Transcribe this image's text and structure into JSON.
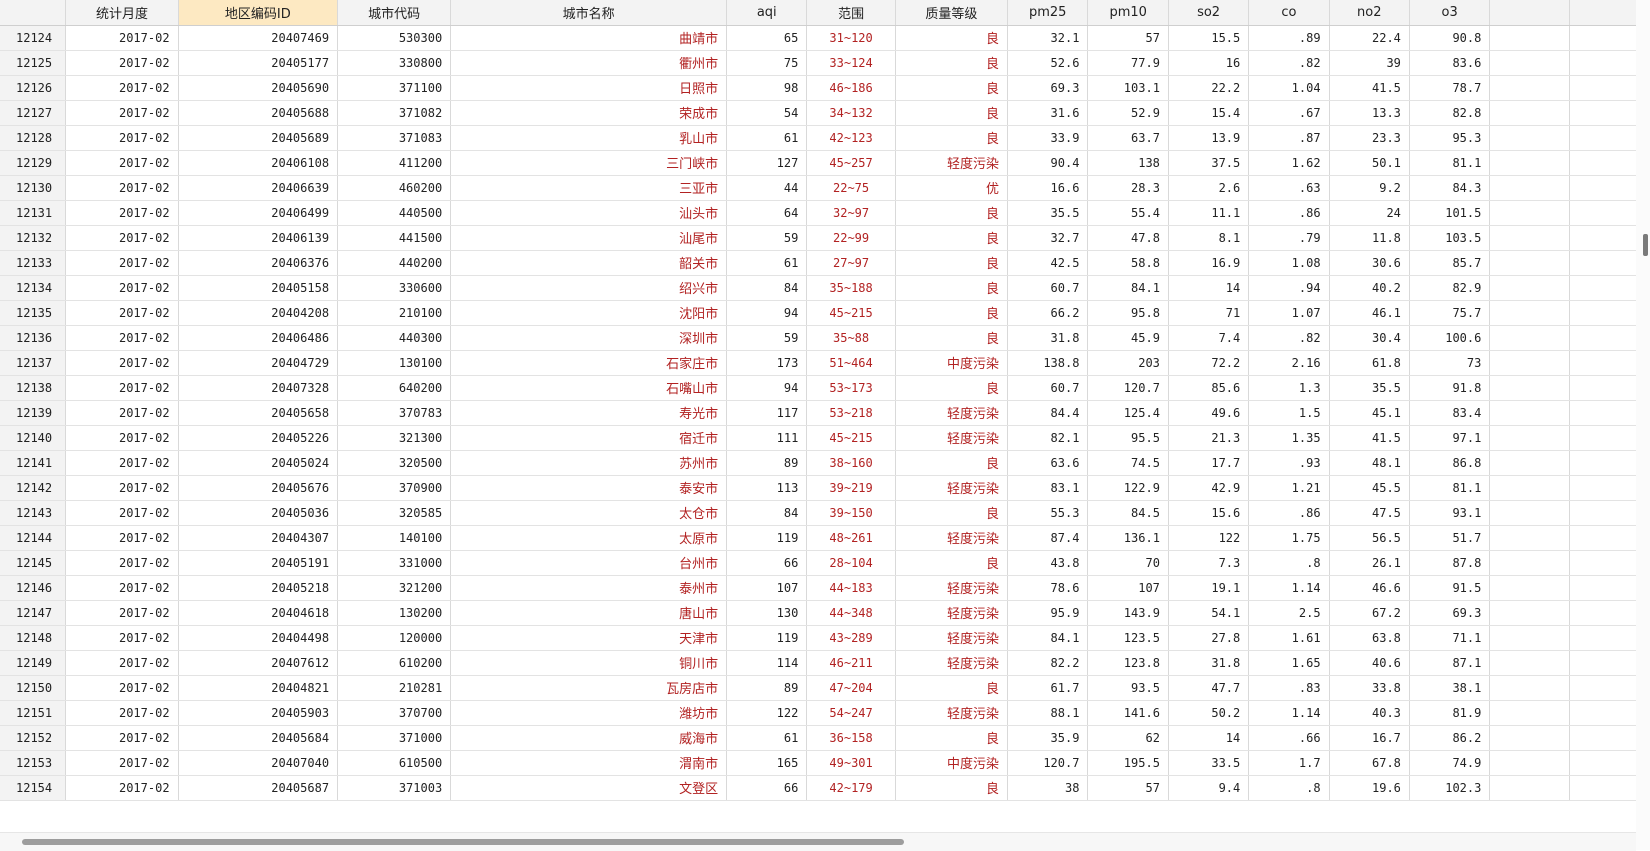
{
  "headers": [
    "",
    "统计月度",
    "地区编码ID",
    "城市代码",
    "城市名称",
    "aqi",
    "范围",
    "质量等级",
    "pm25",
    "pm10",
    "so2",
    "co",
    "no2",
    "o3"
  ],
  "colors": {
    "accent_text": "#b22222",
    "selected_header": "#fde9c2",
    "header_bg": "#f3f3f3"
  },
  "rows": [
    [
      "12124",
      "2017-02",
      "20407469",
      "530300",
      "曲靖市",
      "65",
      "31~120",
      "良",
      "32.1",
      "57",
      "15.5",
      ".89",
      "22.4",
      "90.8"
    ],
    [
      "12125",
      "2017-02",
      "20405177",
      "330800",
      "衢州市",
      "75",
      "33~124",
      "良",
      "52.6",
      "77.9",
      "16",
      ".82",
      "39",
      "83.6"
    ],
    [
      "12126",
      "2017-02",
      "20405690",
      "371100",
      "日照市",
      "98",
      "46~186",
      "良",
      "69.3",
      "103.1",
      "22.2",
      "1.04",
      "41.5",
      "78.7"
    ],
    [
      "12127",
      "2017-02",
      "20405688",
      "371082",
      "荣成市",
      "54",
      "34~132",
      "良",
      "31.6",
      "52.9",
      "15.4",
      ".67",
      "13.3",
      "82.8"
    ],
    [
      "12128",
      "2017-02",
      "20405689",
      "371083",
      "乳山市",
      "61",
      "42~123",
      "良",
      "33.9",
      "63.7",
      "13.9",
      ".87",
      "23.3",
      "95.3"
    ],
    [
      "12129",
      "2017-02",
      "20406108",
      "411200",
      "三门峡市",
      "127",
      "45~257",
      "轻度污染",
      "90.4",
      "138",
      "37.5",
      "1.62",
      "50.1",
      "81.1"
    ],
    [
      "12130",
      "2017-02",
      "20406639",
      "460200",
      "三亚市",
      "44",
      "22~75",
      "优",
      "16.6",
      "28.3",
      "2.6",
      ".63",
      "9.2",
      "84.3"
    ],
    [
      "12131",
      "2017-02",
      "20406499",
      "440500",
      "汕头市",
      "64",
      "32~97",
      "良",
      "35.5",
      "55.4",
      "11.1",
      ".86",
      "24",
      "101.5"
    ],
    [
      "12132",
      "2017-02",
      "20406139",
      "441500",
      "汕尾市",
      "59",
      "22~99",
      "良",
      "32.7",
      "47.8",
      "8.1",
      ".79",
      "11.8",
      "103.5"
    ],
    [
      "12133",
      "2017-02",
      "20406376",
      "440200",
      "韶关市",
      "61",
      "27~97",
      "良",
      "42.5",
      "58.8",
      "16.9",
      "1.08",
      "30.6",
      "85.7"
    ],
    [
      "12134",
      "2017-02",
      "20405158",
      "330600",
      "绍兴市",
      "84",
      "35~188",
      "良",
      "60.7",
      "84.1",
      "14",
      ".94",
      "40.2",
      "82.9"
    ],
    [
      "12135",
      "2017-02",
      "20404208",
      "210100",
      "沈阳市",
      "94",
      "45~215",
      "良",
      "66.2",
      "95.8",
      "71",
      "1.07",
      "46.1",
      "75.7"
    ],
    [
      "12136",
      "2017-02",
      "20406486",
      "440300",
      "深圳市",
      "59",
      "35~88",
      "良",
      "31.8",
      "45.9",
      "7.4",
      ".82",
      "30.4",
      "100.6"
    ],
    [
      "12137",
      "2017-02",
      "20404729",
      "130100",
      "石家庄市",
      "173",
      "51~464",
      "中度污染",
      "138.8",
      "203",
      "72.2",
      "2.16",
      "61.8",
      "73"
    ],
    [
      "12138",
      "2017-02",
      "20407328",
      "640200",
      "石嘴山市",
      "94",
      "53~173",
      "良",
      "60.7",
      "120.7",
      "85.6",
      "1.3",
      "35.5",
      "91.8"
    ],
    [
      "12139",
      "2017-02",
      "20405658",
      "370783",
      "寿光市",
      "117",
      "53~218",
      "轻度污染",
      "84.4",
      "125.4",
      "49.6",
      "1.5",
      "45.1",
      "83.4"
    ],
    [
      "12140",
      "2017-02",
      "20405226",
      "321300",
      "宿迁市",
      "111",
      "45~215",
      "轻度污染",
      "82.1",
      "95.5",
      "21.3",
      "1.35",
      "41.5",
      "97.1"
    ],
    [
      "12141",
      "2017-02",
      "20405024",
      "320500",
      "苏州市",
      "89",
      "38~160",
      "良",
      "63.6",
      "74.5",
      "17.7",
      ".93",
      "48.1",
      "86.8"
    ],
    [
      "12142",
      "2017-02",
      "20405676",
      "370900",
      "泰安市",
      "113",
      "39~219",
      "轻度污染",
      "83.1",
      "122.9",
      "42.9",
      "1.21",
      "45.5",
      "81.1"
    ],
    [
      "12143",
      "2017-02",
      "20405036",
      "320585",
      "太仓市",
      "84",
      "39~150",
      "良",
      "55.3",
      "84.5",
      "15.6",
      ".86",
      "47.5",
      "93.1"
    ],
    [
      "12144",
      "2017-02",
      "20404307",
      "140100",
      "太原市",
      "119",
      "48~261",
      "轻度污染",
      "87.4",
      "136.1",
      "122",
      "1.75",
      "56.5",
      "51.7"
    ],
    [
      "12145",
      "2017-02",
      "20405191",
      "331000",
      "台州市",
      "66",
      "28~104",
      "良",
      "43.8",
      "70",
      "7.3",
      ".8",
      "26.1",
      "87.8"
    ],
    [
      "12146",
      "2017-02",
      "20405218",
      "321200",
      "泰州市",
      "107",
      "44~183",
      "轻度污染",
      "78.6",
      "107",
      "19.1",
      "1.14",
      "46.6",
      "91.5"
    ],
    [
      "12147",
      "2017-02",
      "20404618",
      "130200",
      "唐山市",
      "130",
      "44~348",
      "轻度污染",
      "95.9",
      "143.9",
      "54.1",
      "2.5",
      "67.2",
      "69.3"
    ],
    [
      "12148",
      "2017-02",
      "20404498",
      "120000",
      "天津市",
      "119",
      "43~289",
      "轻度污染",
      "84.1",
      "123.5",
      "27.8",
      "1.61",
      "63.8",
      "71.1"
    ],
    [
      "12149",
      "2017-02",
      "20407612",
      "610200",
      "铜川市",
      "114",
      "46~211",
      "轻度污染",
      "82.2",
      "123.8",
      "31.8",
      "1.65",
      "40.6",
      "87.1"
    ],
    [
      "12150",
      "2017-02",
      "20404821",
      "210281",
      "瓦房店市",
      "89",
      "47~204",
      "良",
      "61.7",
      "93.5",
      "47.7",
      ".83",
      "33.8",
      "38.1"
    ],
    [
      "12151",
      "2017-02",
      "20405903",
      "370700",
      "潍坊市",
      "122",
      "54~247",
      "轻度污染",
      "88.1",
      "141.6",
      "50.2",
      "1.14",
      "40.3",
      "81.9"
    ],
    [
      "12152",
      "2017-02",
      "20405684",
      "371000",
      "威海市",
      "61",
      "36~158",
      "良",
      "35.9",
      "62",
      "14",
      ".66",
      "16.7",
      "86.2"
    ],
    [
      "12153",
      "2017-02",
      "20407040",
      "610500",
      "渭南市",
      "165",
      "49~301",
      "中度污染",
      "120.7",
      "195.5",
      "33.5",
      "1.7",
      "67.8",
      "74.9"
    ],
    [
      "12154",
      "2017-02",
      "20405687",
      "371003",
      "文登区",
      "66",
      "42~179",
      "良",
      "38",
      "57",
      "9.4",
      ".8",
      "19.6",
      "102.3"
    ]
  ]
}
